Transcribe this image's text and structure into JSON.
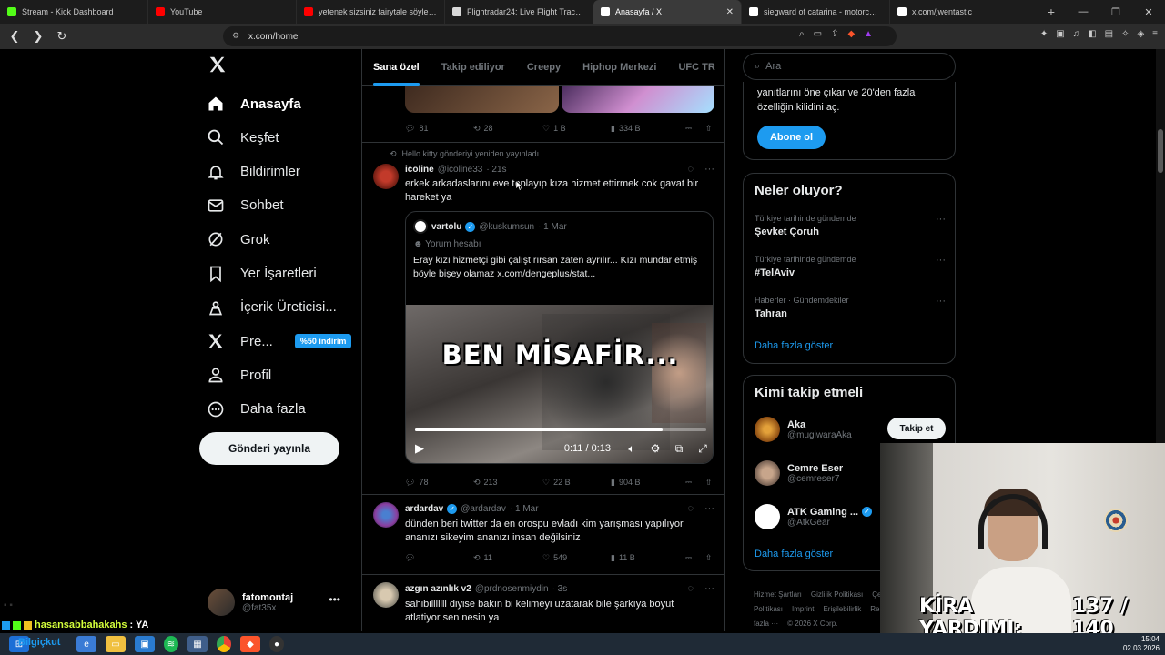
{
  "browser": {
    "tabs": [
      {
        "title": "Stream - Kick Dashboard",
        "color": "#53fc18",
        "active": false
      },
      {
        "title": "YouTube",
        "color": "#ff0000",
        "active": false
      },
      {
        "title": "yetenek sizsiniz fairytale söyleyen ad",
        "color": "#ff0000",
        "active": false
      },
      {
        "title": "Flightradar24: Live Flight Tracker - Re",
        "color": "#d8d8d8",
        "active": false
      },
      {
        "title": "Anasayfa / X",
        "color": "#ffffff",
        "active": true
      },
      {
        "title": "siegward of catarina - motorcu nefre",
        "color": "#ffffff",
        "active": false
      },
      {
        "title": "x.com/jwentastic",
        "color": "#ffffff",
        "active": false
      }
    ],
    "url": "x.com/home"
  },
  "nav": {
    "items": [
      {
        "label": "Anasayfa",
        "icon": "home-icon",
        "active": true
      },
      {
        "label": "Keşfet",
        "icon": "search-icon"
      },
      {
        "label": "Bildirimler",
        "icon": "bell-icon"
      },
      {
        "label": "Sohbet",
        "icon": "mail-icon"
      },
      {
        "label": "Grok",
        "icon": "grok-icon"
      },
      {
        "label": "Yer İşaretleri",
        "icon": "bookmark-icon"
      },
      {
        "label": "İçerik Üreticisi...",
        "icon": "creator-icon"
      },
      {
        "label": "Pre...",
        "icon": "x-premium-icon",
        "badge": "%50 indirim"
      },
      {
        "label": "Profil",
        "icon": "person-icon"
      },
      {
        "label": "Daha fazla",
        "icon": "more-circle-icon"
      }
    ],
    "post_button": "Gönderi yayınla",
    "profile": {
      "name": "fatomontaj",
      "handle": "@fat35x"
    }
  },
  "feed": {
    "tabs": [
      "Sana özel",
      "Takip ediliyor",
      "Creepy",
      "Hiphop Merkezi",
      "UFC TR"
    ],
    "top_actions": {
      "replies": "81",
      "reposts": "28",
      "likes": "1 B",
      "views": "334 B"
    },
    "tweet1": {
      "repost_note": "Hello kitty gönderiyi yeniden yayınladı",
      "name": "icoline",
      "handle": "@icoline33",
      "time": "· 21s",
      "text": "erkek arkadaslarını eve toplayıp kıza hizmet ettirmek cok gavat bir hareket ya",
      "quote": {
        "name": "vartolu",
        "handle": "@kuskumsun",
        "time": "· 1 Mar",
        "sub": "Yorum hesabı",
        "text": "Eray kızı hizmetçi gibi çalıştırırsan zaten ayrılır... Kızı mundar etmiş böyle bişey olamaz  x.com/dengeplus/stat...",
        "video_caption": "BEN MİSAFİR...",
        "video_time": "0:11 / 0:13",
        "progress": 0.85
      },
      "actions": {
        "replies": "78",
        "reposts": "213",
        "likes": "22 B",
        "views": "904 B"
      }
    },
    "tweet2": {
      "name": "ardardav",
      "handle": "@ardardav",
      "time": "· 1 Mar",
      "text": "dünden beri twitter da en orospu evladı kim yarışması yapılıyor ananızı sikeyim ananızı insan değilsiniz",
      "actions": {
        "replies": "",
        "reposts": "11",
        "likes": "549",
        "views": "11 B"
      }
    },
    "tweet3": {
      "name": "azgın azınlık v2",
      "handle": "@prdnosenmiydin",
      "time": "· 3s",
      "text": "sahibilllllll diyise bakın bi kelimeyi uzatarak bile şarkıya boyut atlatiyor sen nesin ya"
    }
  },
  "right": {
    "search_placeholder": "Ara",
    "premium_text": "yanıtlarını öne çıkar ve 20'den fazla özelliğin kilidini aç.",
    "subscribe": "Abone ol",
    "trends_title": "Neler oluyor?",
    "trends": [
      {
        "context": "Türkiye tarihinde gündemde",
        "title": "Şevket Çoruh"
      },
      {
        "context": "Türkiye tarihinde gündemde",
        "title": "#TelAviv"
      },
      {
        "context": "Haberler · Gündemdekiler",
        "title": "Tahran"
      }
    ],
    "show_more": "Daha fazla göster",
    "who_title": "Kimi takip etmeli",
    "who": [
      {
        "name": "Aka",
        "handle": "@mugiwaraAka",
        "verified": false
      },
      {
        "name": "Cemre Eser",
        "handle": "@cemreser7",
        "verified": false
      },
      {
        "name": "ATK Gaming ...",
        "handle": "@AtkGear",
        "verified": true
      }
    ],
    "follow": "Takip et",
    "footer": [
      "Hizmet Şartları",
      "Gizlilik Politikası",
      "Çerez Politikası",
      "Imprint",
      "Erişilebilirlik",
      "Reklam bilgisi",
      "Daha fazla ···",
      "© 2026 X Corp."
    ]
  },
  "overlay": {
    "banner": "KİRA YARDIMI:",
    "banner_count": "137 / 140",
    "chat_name": "hasansabbahakahs",
    "chat_msg": ": YA"
  },
  "taskbar": {
    "time": "15:04",
    "date": "02.03.2026",
    "search_label": "Bilgiçkut"
  }
}
